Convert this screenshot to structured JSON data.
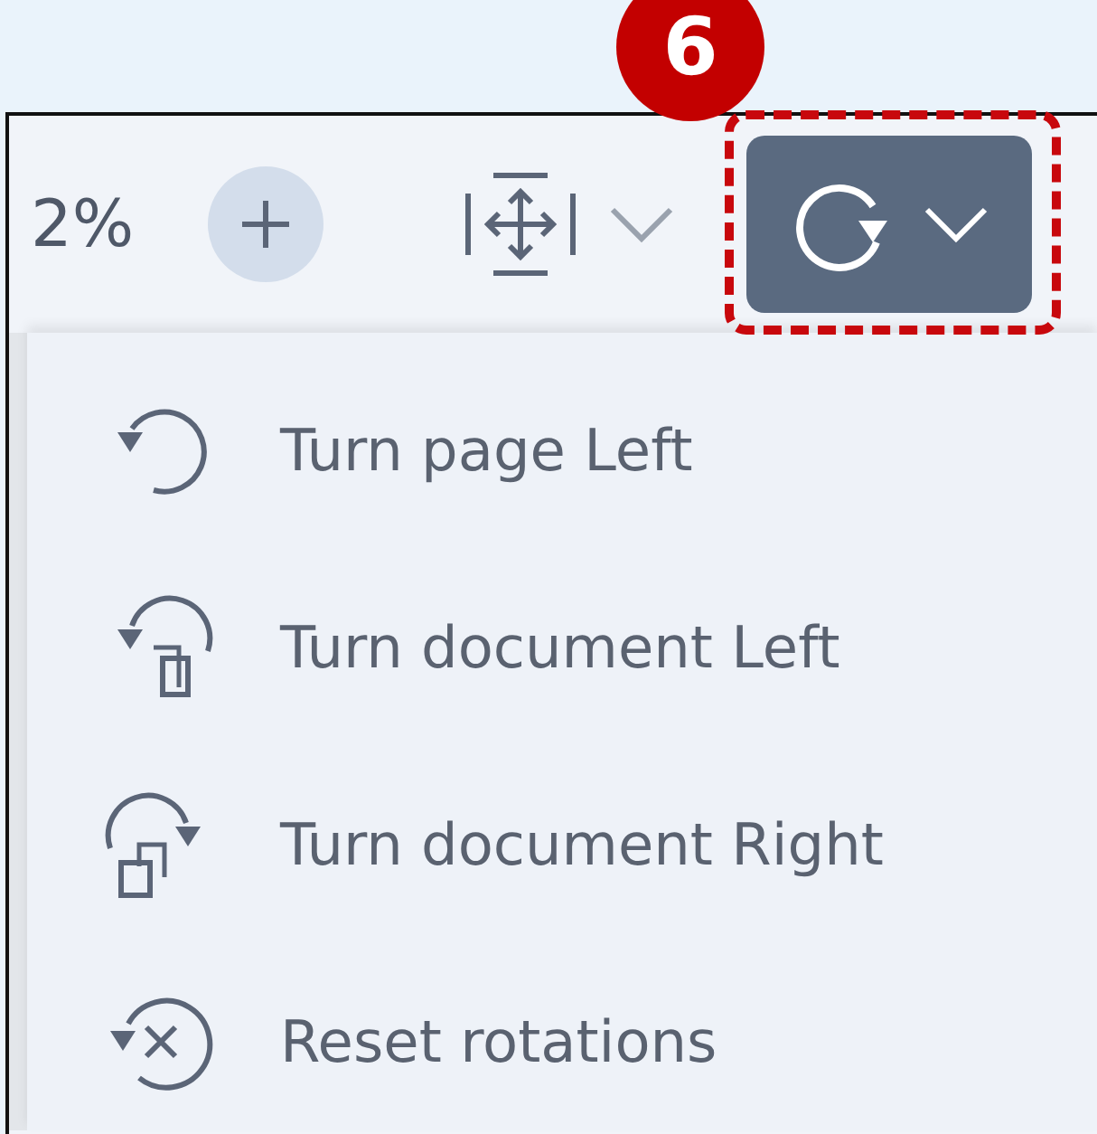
{
  "toolbar": {
    "zoom_level": "2%",
    "step_marker": "6"
  },
  "rotate_menu": {
    "items": [
      {
        "kind": "page-left",
        "label": "Turn page Left"
      },
      {
        "kind": "document-left",
        "label": "Turn document Left"
      },
      {
        "kind": "document-right",
        "label": "Turn document Right"
      },
      {
        "kind": "reset",
        "label": "Reset rotations"
      }
    ]
  }
}
